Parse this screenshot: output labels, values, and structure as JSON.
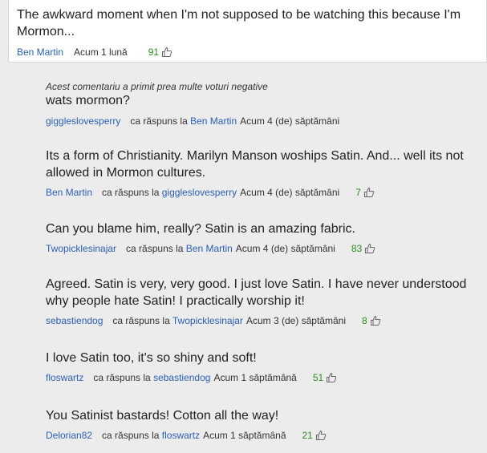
{
  "top_comment": {
    "text": "The awkward moment when I'm not supposed to be watching this because I'm Mormon...",
    "author": "Ben Martin",
    "time": "Acum 1 lună",
    "votes": "91"
  },
  "replies": [
    {
      "note": "Acest comentariu a primit prea multe voturi negative",
      "text": "wats mormon?",
      "author": "giggleslovesperry",
      "reply_label": "ca răspuns la",
      "reply_target": "Ben Martin",
      "time": "Acum 4 (de) săptămâni",
      "votes": ""
    },
    {
      "text": "Its a form of Christianity. Marilyn Manson woships Satin. And... well its not allowed in Mormon cultures.",
      "author": "Ben Martin",
      "reply_label": "ca răspuns la",
      "reply_target": "giggleslovesperry",
      "time": "Acum 4 (de) săptămâni",
      "votes": "7"
    },
    {
      "text": "Can you blame him, really? Satin is an amazing fabric.",
      "author": "Twopicklesinajar",
      "reply_label": "ca răspuns la",
      "reply_target": "Ben Martin",
      "time": "Acum 4 (de) săptămâni",
      "votes": "83"
    },
    {
      "text": "Agreed. Satin is very, very good. I just love Satin. I have never understood why people hate Satin! I practically worship it!",
      "author": "sebastiendog",
      "reply_label": "ca răspuns la",
      "reply_target": "Twopicklesinajar",
      "time": "Acum 3 (de) săptămâni",
      "votes": "8"
    },
    {
      "text": "I love Satin too, it's so shiny and soft!",
      "author": "floswartz",
      "reply_label": "ca răspuns la",
      "reply_target": "sebastiendog",
      "time": "Acum 1 săptămână",
      "votes": "51"
    },
    {
      "text": "You Satinist bastards! Cotton all the way!",
      "author": "Delorian82",
      "reply_label": "ca răspuns la",
      "reply_target": "floswartz",
      "time": "Acum 1 săptămână",
      "votes": "21"
    }
  ],
  "colors": {
    "link": "#2b5fb3",
    "votes": "#2e8b1e",
    "background": "#ececec"
  },
  "icons": {
    "vote": "thumbs-up-icon"
  }
}
